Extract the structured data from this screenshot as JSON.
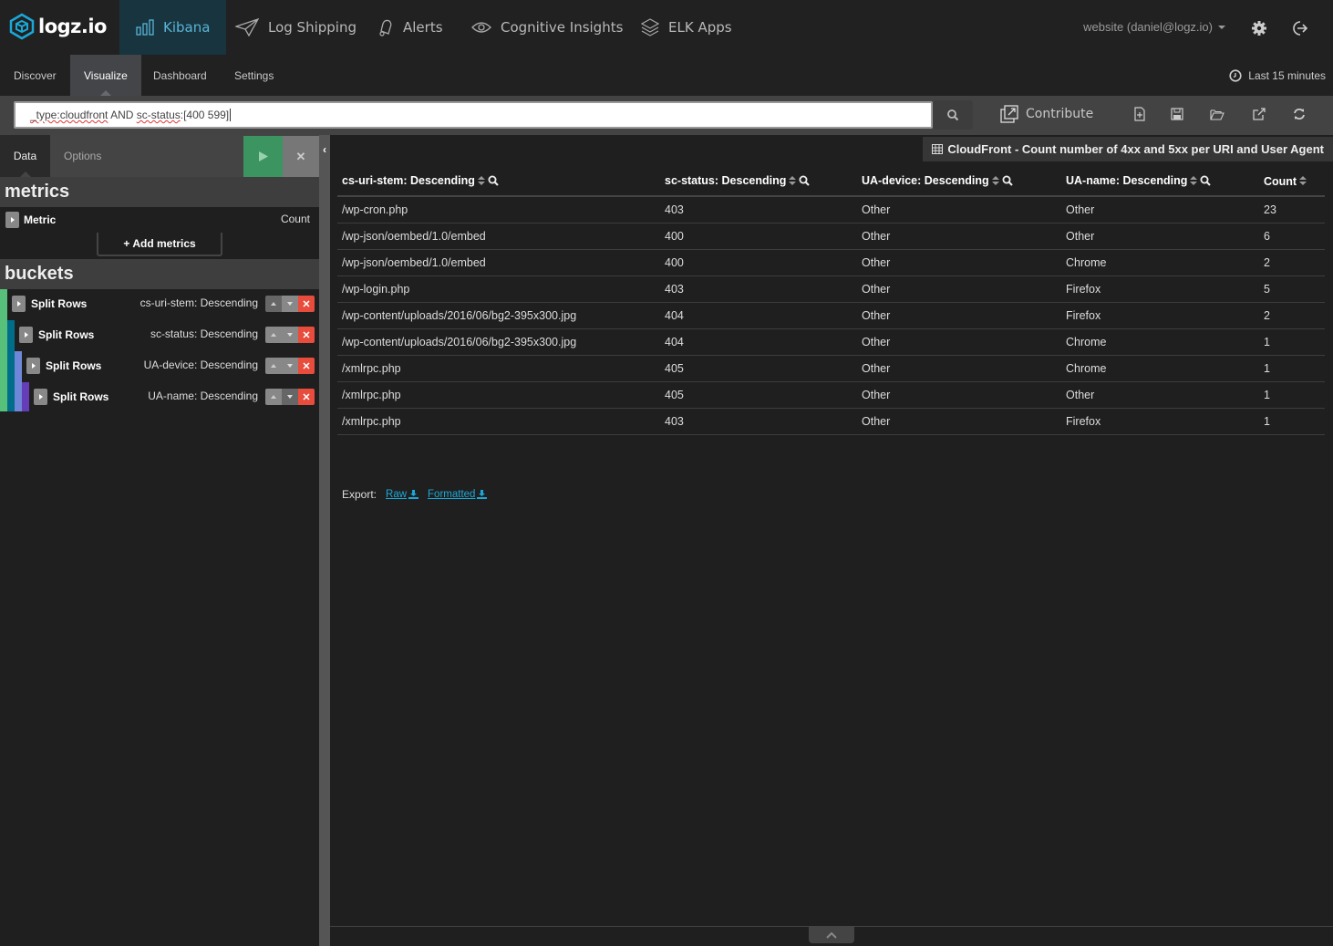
{
  "brand": {
    "name": "logz.io",
    "accent": "#1ba8d8"
  },
  "topnav": {
    "items": [
      {
        "label": "Kibana",
        "icon": "bar-chart-icon",
        "active": true
      },
      {
        "label": "Log Shipping",
        "icon": "paper-plane-icon"
      },
      {
        "label": "Alerts",
        "icon": "bell-icon"
      },
      {
        "label": "Cognitive Insights",
        "icon": "eye-icon"
      },
      {
        "label": "ELK Apps",
        "icon": "layers-icon"
      }
    ],
    "account": "website (daniel@logz.io)"
  },
  "subnav": {
    "tabs": [
      "Discover",
      "Visualize",
      "Dashboard",
      "Settings"
    ],
    "active": "Visualize",
    "time_range": "Last 15 minutes"
  },
  "query": {
    "part1": "_type:cloudfront",
    "part2": " AND ",
    "part3": "sc-status",
    "part4": ":[400 599]"
  },
  "toolbar": {
    "contribute_label": "Contribute",
    "tools": [
      "new-visualization-icon",
      "save-icon",
      "open-icon",
      "share-icon",
      "refresh-icon"
    ]
  },
  "sidebar": {
    "tabs": {
      "data": "Data",
      "options": "Options"
    },
    "metrics_header": "metrics",
    "metric": {
      "label": "Metric",
      "value": "Count"
    },
    "add_metrics_label": "Add metrics",
    "buckets_header": "buckets",
    "buckets": [
      {
        "label": "Split Rows",
        "value": "cs-uri-stem: Descending"
      },
      {
        "label": "Split Rows",
        "value": "sc-status: Descending"
      },
      {
        "label": "Split Rows",
        "value": "UA-device: Descending"
      },
      {
        "label": "Split Rows",
        "value": "UA-name: Descending"
      }
    ],
    "bucket_colors": [
      "#57c17b",
      "#006e8a",
      "#6f87d8",
      "#663db8"
    ]
  },
  "visualization": {
    "title": "CloudFront - Count number of 4xx and 5xx per URI and User Agent",
    "columns": [
      "cs-uri-stem: Descending",
      "sc-status: Descending",
      "UA-device: Descending",
      "UA-name: Descending",
      "Count"
    ],
    "rows": [
      [
        "/wp-cron.php",
        "403",
        "Other",
        "Other",
        "23"
      ],
      [
        "/wp-json/oembed/1.0/embed",
        "400",
        "Other",
        "Other",
        "6"
      ],
      [
        "/wp-json/oembed/1.0/embed",
        "400",
        "Other",
        "Chrome",
        "2"
      ],
      [
        "/wp-login.php",
        "403",
        "Other",
        "Firefox",
        "5"
      ],
      [
        "/wp-content/uploads/2016/06/bg2-395x300.jpg",
        "404",
        "Other",
        "Firefox",
        "2"
      ],
      [
        "/wp-content/uploads/2016/06/bg2-395x300.jpg",
        "404",
        "Other",
        "Chrome",
        "1"
      ],
      [
        "/xmlrpc.php",
        "405",
        "Other",
        "Chrome",
        "1"
      ],
      [
        "/xmlrpc.php",
        "405",
        "Other",
        "Other",
        "1"
      ],
      [
        "/xmlrpc.php",
        "403",
        "Other",
        "Firefox",
        "1"
      ]
    ],
    "export_label": "Export:",
    "export_raw": "Raw",
    "export_formatted": "Formatted"
  }
}
